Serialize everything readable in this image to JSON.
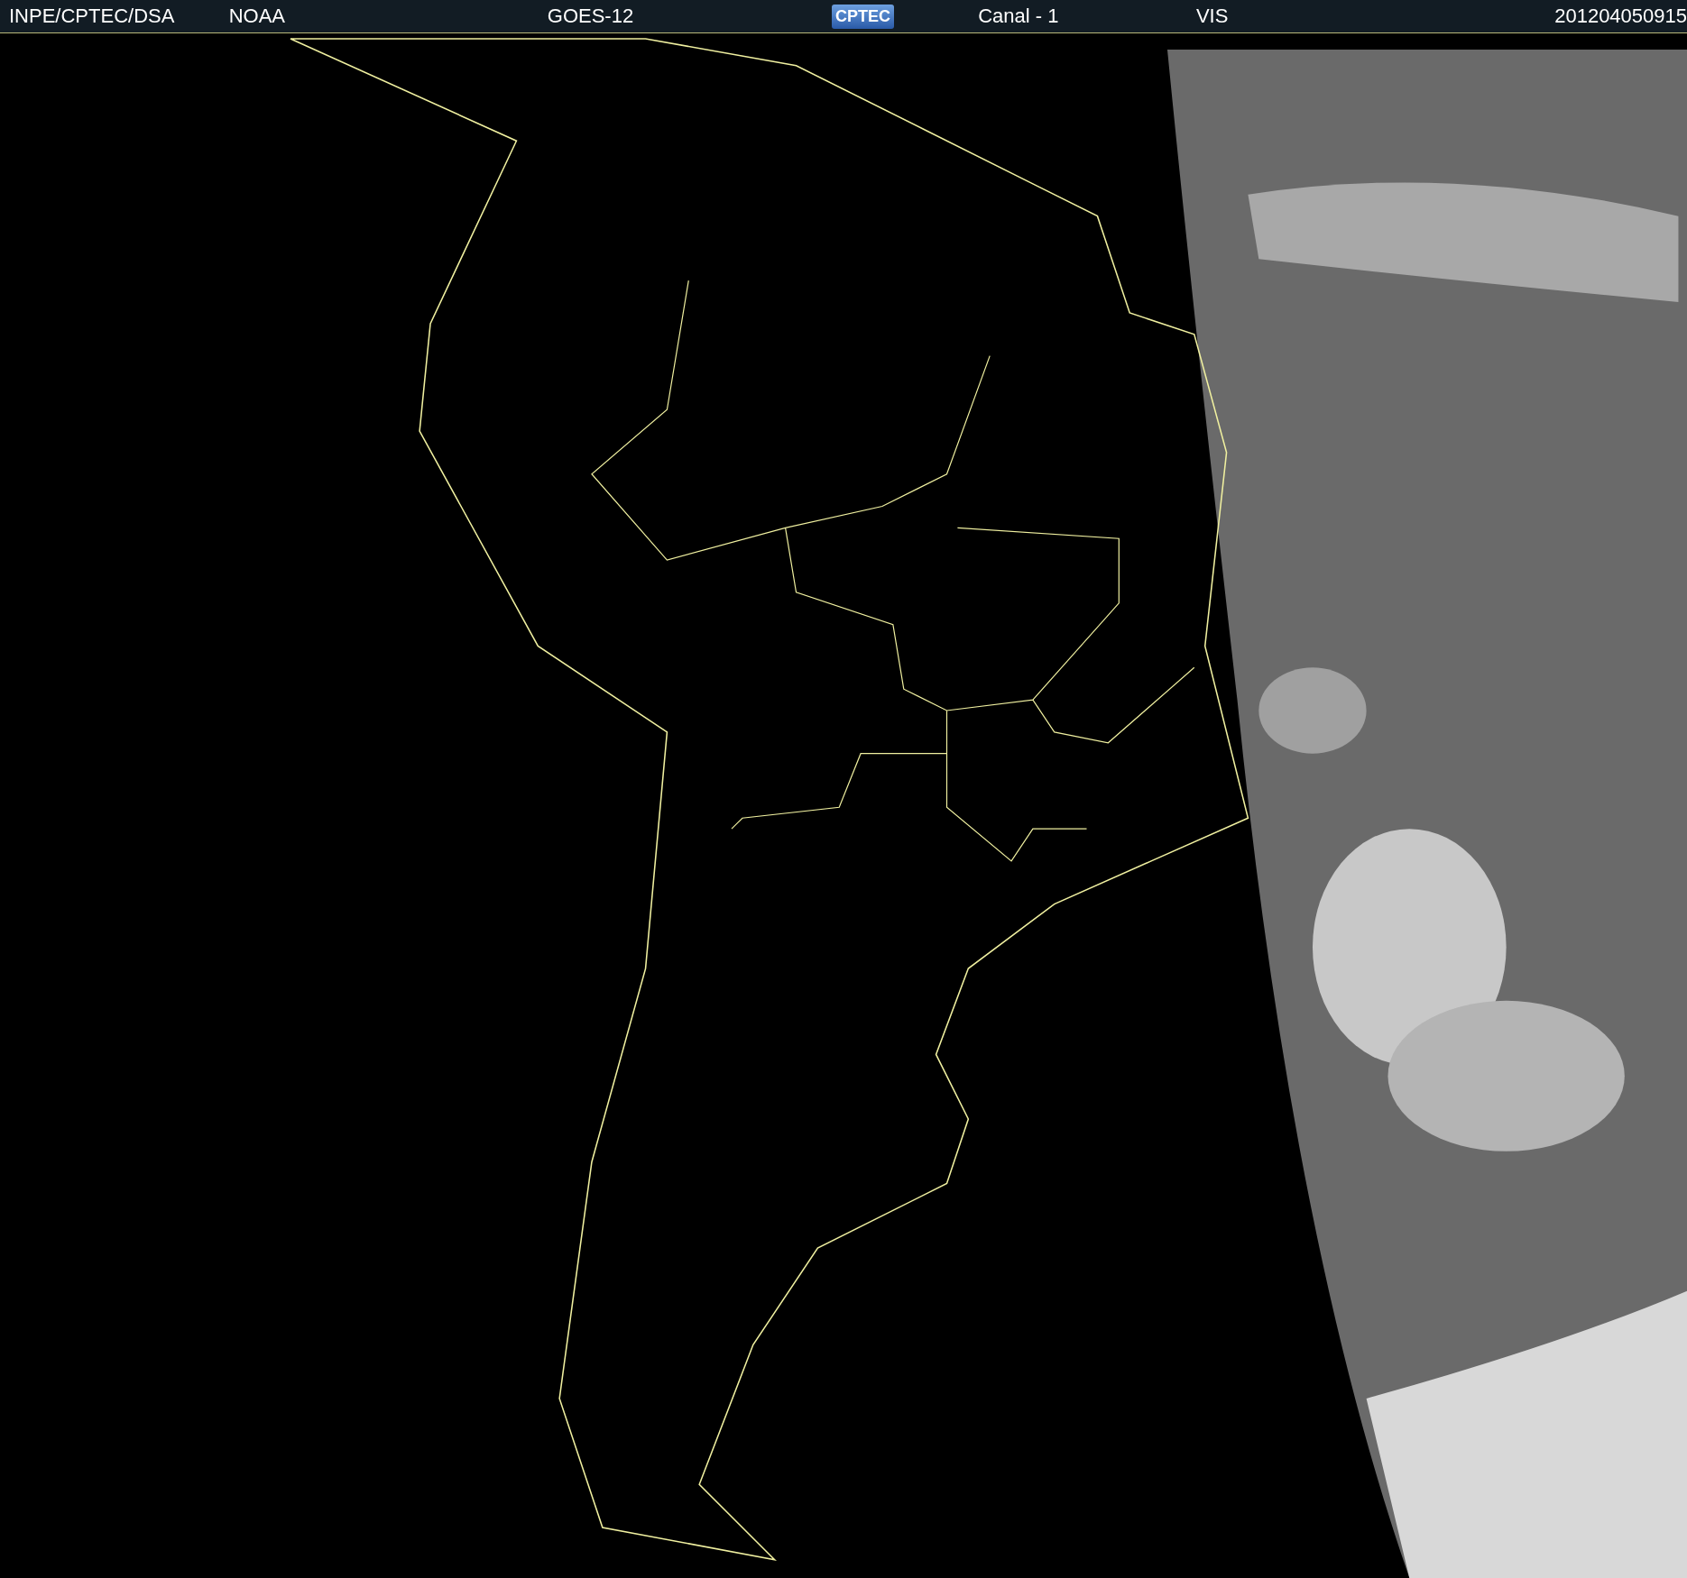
{
  "header": {
    "items": [
      {
        "kind": "text",
        "text": "INPE/CPTEC/DSA"
      },
      {
        "kind": "text",
        "text": "NOAA"
      },
      {
        "kind": "text",
        "text": "GOES-12"
      },
      {
        "kind": "logo",
        "text": "CPTEC"
      },
      {
        "kind": "text",
        "text": "Canal - 1"
      },
      {
        "kind": "text",
        "text": "VIS"
      },
      {
        "kind": "text",
        "text": "201204050915"
      }
    ]
  }
}
